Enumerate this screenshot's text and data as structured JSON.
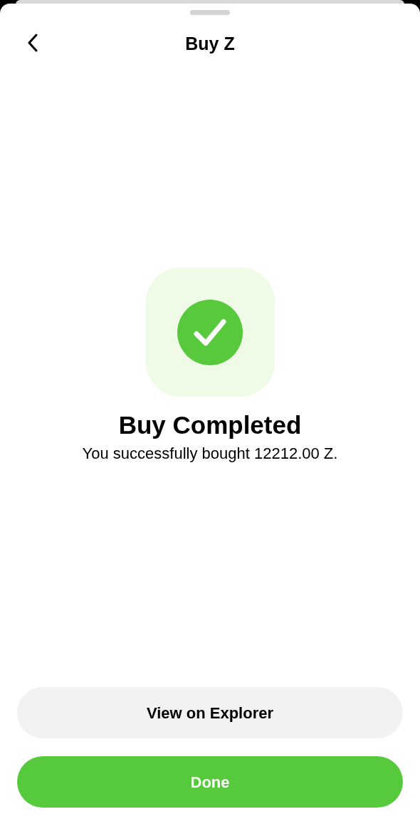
{
  "header": {
    "title": "Buy Z"
  },
  "result": {
    "title": "Buy Completed",
    "message": "You successfully bought 12212.00 Z."
  },
  "buttons": [
    {
      "label": "View on Explorer",
      "kind": "secondary"
    },
    {
      "label": "Done",
      "kind": "primary"
    }
  ]
}
